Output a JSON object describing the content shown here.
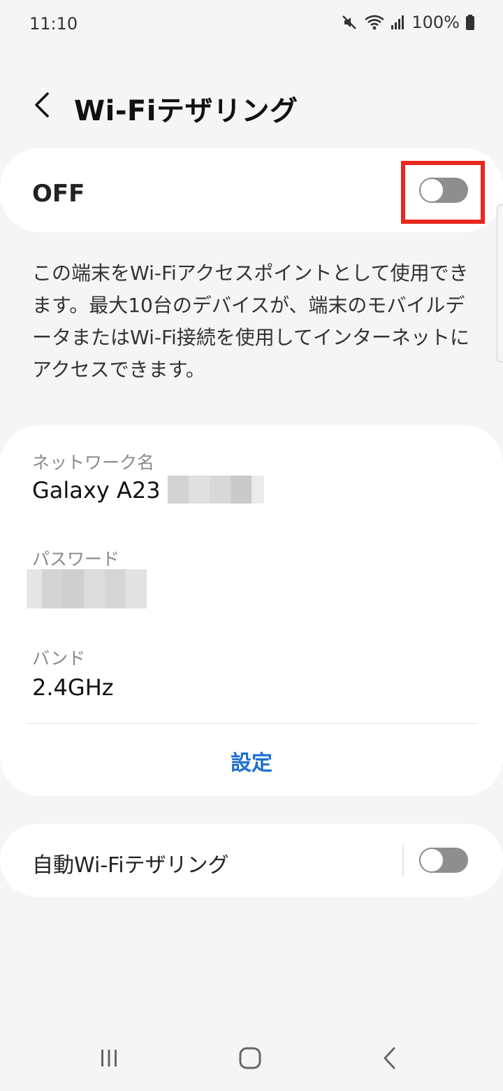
{
  "status_bar": {
    "time": "11:10",
    "battery_text": "100%",
    "icons": [
      "mute-icon",
      "wifi-icon",
      "signal-icon",
      "battery-icon"
    ]
  },
  "header": {
    "back_icon": "chevron-left-icon",
    "title": "Wi-Fiテザリング"
  },
  "main_switch": {
    "label": "OFF",
    "state": "off"
  },
  "description": "この端末をWi-Fiアクセスポイントとして使用できます。最大10台のデバイスが、端末のモバイルデータまたはWi-Fi接続を使用してインターネットにアクセスできます。",
  "network": {
    "name_label": "ネットワーク名",
    "name_value": "Galaxy A23",
    "password_label": "パスワード",
    "band_label": "バンド",
    "band_value": "2.4GHz",
    "settings_button": "設定"
  },
  "auto_hotspot": {
    "label": "自動Wi-Fiテザリング",
    "state": "off"
  },
  "nav": {
    "icons": [
      "recent-apps-icon",
      "home-icon",
      "back-icon"
    ]
  },
  "colors": {
    "accent": "#1e6fd0",
    "highlight": "#e8281e",
    "toggle_off": "#8e8e8e",
    "background": "#f5f5f5"
  }
}
